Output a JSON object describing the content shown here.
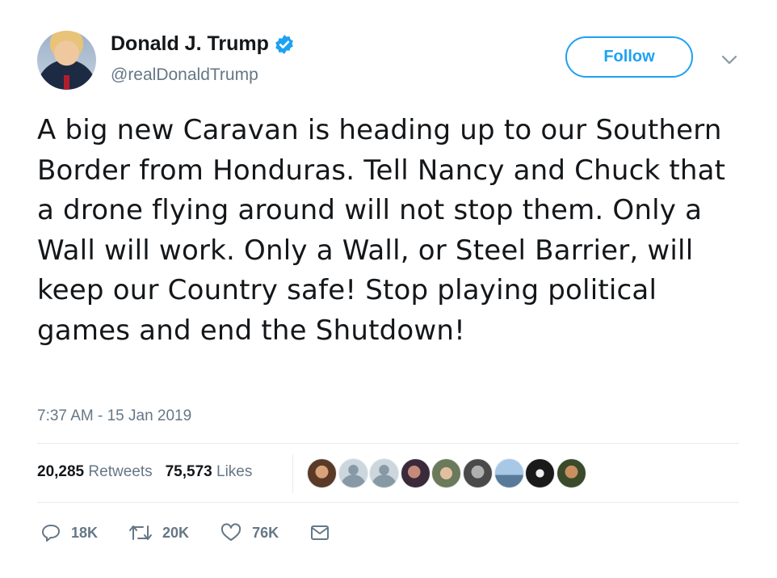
{
  "author": {
    "name": "Donald J. Trump",
    "handle": "@realDonaldTrump"
  },
  "follow_label": "Follow",
  "tweet": {
    "text": "A big new Caravan is heading up to our Southern Border from Honduras. Tell Nancy and Chuck that a drone flying around will not stop them. Only a Wall will work. Only a Wall, or Steel Barrier, will keep our Country safe! Stop playing political games and end the Shutdown!",
    "timestamp": "7:37 AM - 15 Jan 2019"
  },
  "stats": {
    "retweets_count": "20,285",
    "retweets_label": "Retweets",
    "likes_count": "75,573",
    "likes_label": "Likes"
  },
  "actions": {
    "replies": "18K",
    "retweets": "20K",
    "likes": "76K"
  },
  "colors": {
    "accent": "#1da1f2",
    "text": "#14171a",
    "muted": "#657786"
  },
  "icons": [
    "verified-badge-icon",
    "chevron-down-icon",
    "reply-icon",
    "retweet-icon",
    "like-icon",
    "message-icon"
  ]
}
